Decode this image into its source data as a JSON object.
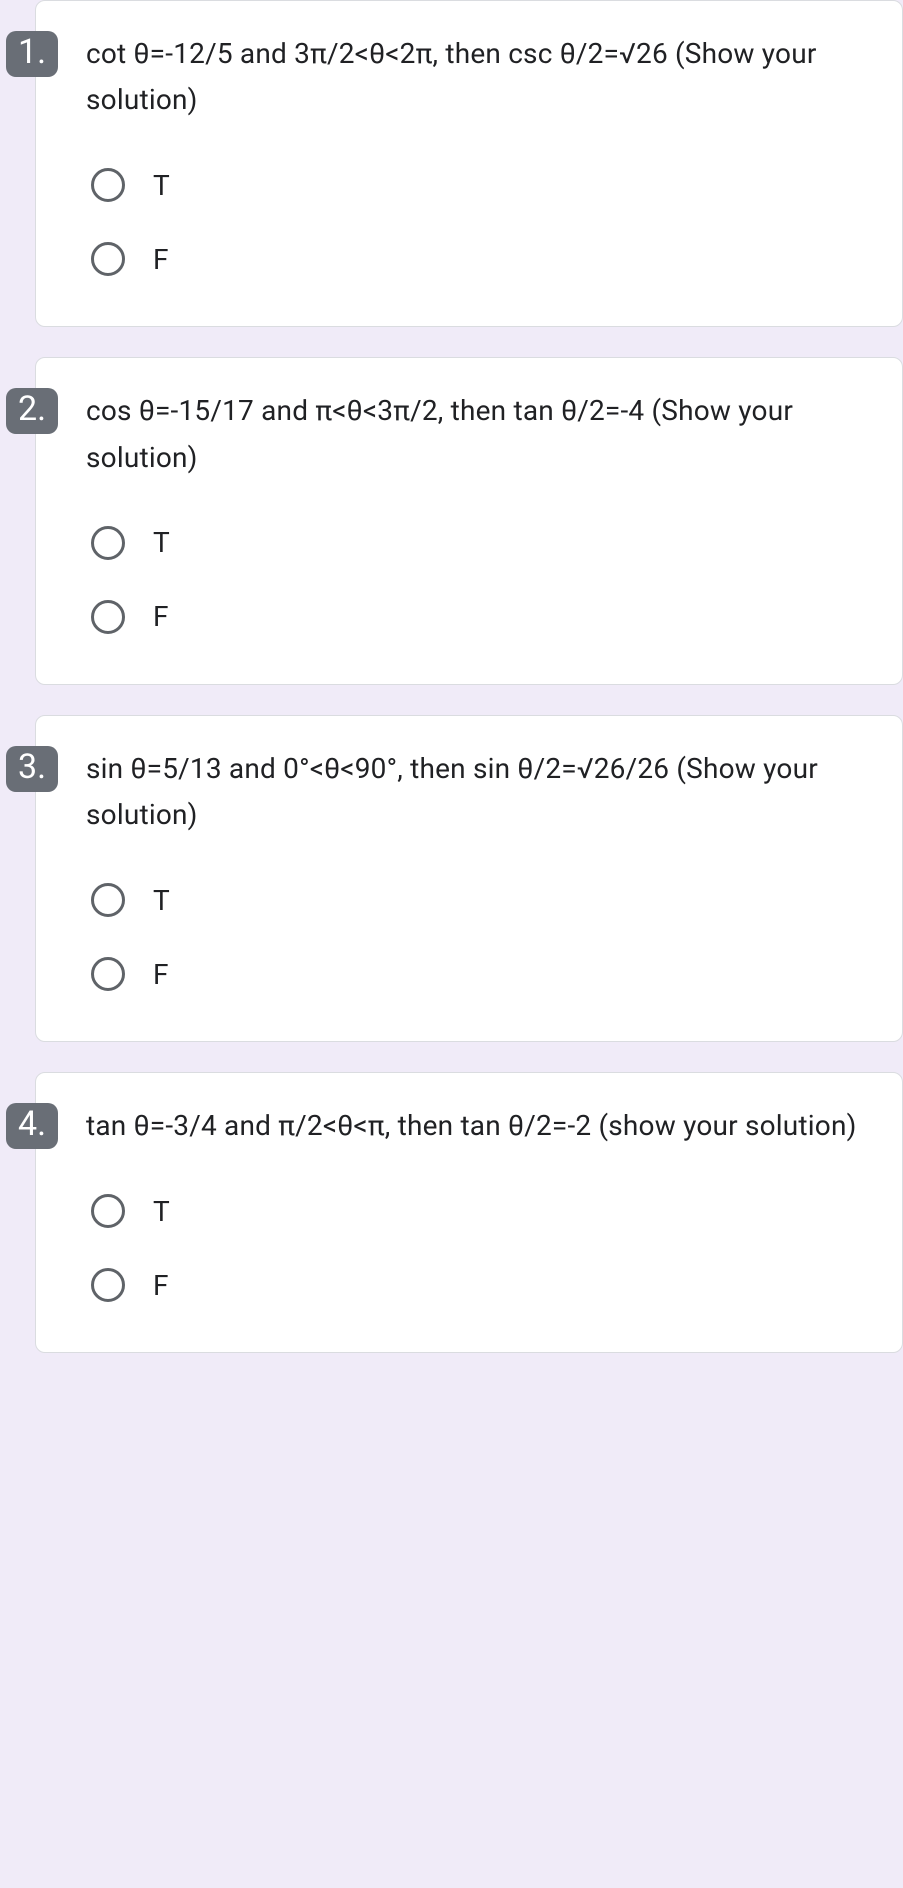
{
  "questions": [
    {
      "number": "1.",
      "text": "cot θ=-12/5 and 3π/2<θ<2π, then csc θ/2=√26 (Show your solution)",
      "options": [
        {
          "label": "T"
        },
        {
          "label": "F"
        }
      ]
    },
    {
      "number": "2.",
      "text": "cos θ=-15/17 and π<θ<3π/2, then tan θ/2=-4 (Show your solution)",
      "options": [
        {
          "label": "T"
        },
        {
          "label": "F"
        }
      ]
    },
    {
      "number": "3.",
      "text": "sin θ=5/13 and 0°<θ<90°, then sin θ/2=√26/26 (Show your solution)",
      "options": [
        {
          "label": "T"
        },
        {
          "label": "F"
        }
      ]
    },
    {
      "number": "4.",
      "text": "tan θ=-3/4 and π/2<θ<π, then tan θ/2=-2 (show your solution)",
      "options": [
        {
          "label": "T"
        },
        {
          "label": "F"
        }
      ]
    }
  ]
}
